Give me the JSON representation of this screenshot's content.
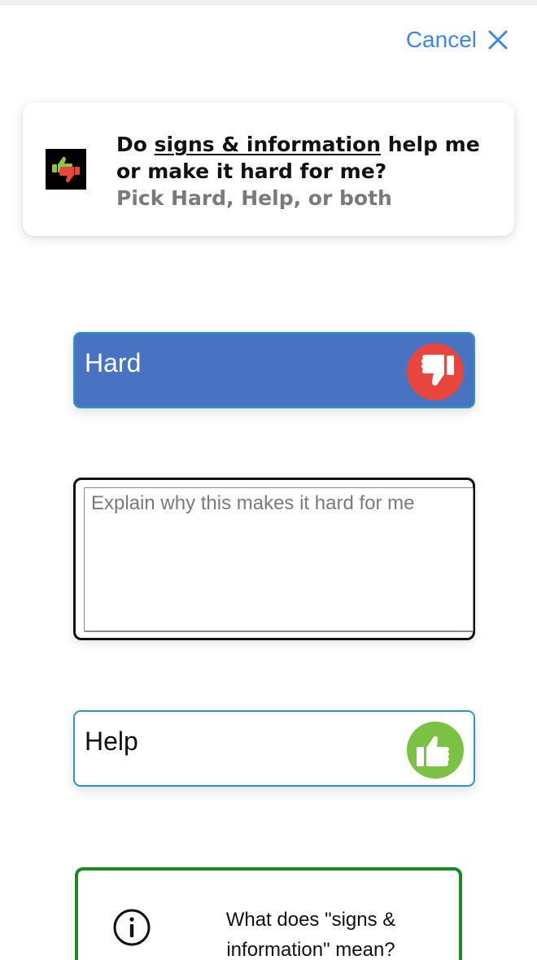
{
  "header": {
    "cancel_label": "Cancel",
    "cancel_icon": "close-icon",
    "accent_color": "#3f86e6"
  },
  "prompt": {
    "icon": "thumbs-up-down-icon",
    "line1_prefix": "Do ",
    "line1_topic": "signs & information",
    "line1_suffix": " help me",
    "line2": "or make it hard for me?",
    "subtitle": "Pick Hard, Help, or both"
  },
  "hard_option": {
    "label": "Hard",
    "icon": "thumbs-down-icon",
    "selected": true,
    "background_color": "#4872c2",
    "icon_color": "#e8453c"
  },
  "explanation": {
    "value": "",
    "placeholder": "Explain why this makes it hard for me"
  },
  "help_option": {
    "label": "Help",
    "icon": "thumbs-up-icon",
    "selected": false,
    "icon_color": "#7cc242"
  },
  "info": {
    "icon": "info-icon",
    "line1": "What does \"signs &",
    "line2": "information\" mean?",
    "border_color": "#1a8a1e"
  }
}
